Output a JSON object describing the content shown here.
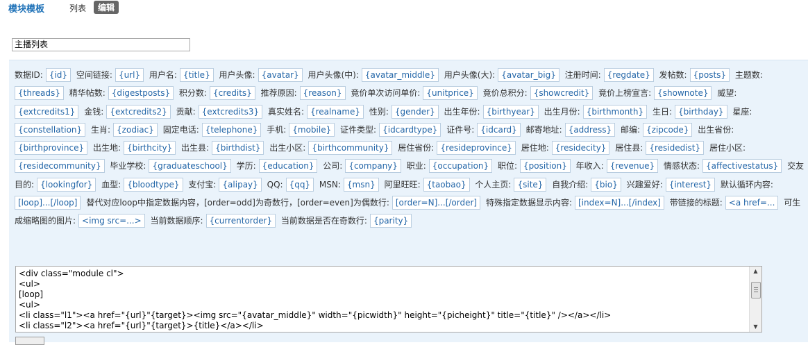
{
  "header": {
    "title": "模块模板",
    "tab_list": "列表",
    "tab_edit": "编辑"
  },
  "form": {
    "name_value": "主播列表"
  },
  "help": {
    "fields": [
      [
        "数据ID:",
        "{id}"
      ],
      [
        "空间链接:",
        "{url}"
      ],
      [
        "用户名:",
        "{title}"
      ],
      [
        "用户头像:",
        "{avatar}"
      ],
      [
        "用户头像(中):",
        "{avatar_middle}"
      ],
      [
        "用户头像(大):",
        "{avatar_big}"
      ],
      [
        "注册时间:",
        "{regdate}"
      ],
      [
        "发帖数:",
        "{posts}"
      ],
      [
        "主题数:",
        "{threads}"
      ],
      [
        "精华帖数:",
        "{digestposts}"
      ],
      [
        "积分数:",
        "{credits}"
      ],
      [
        "推荐原因:",
        "{reason}"
      ],
      [
        "竟价单次访问单价:",
        "{unitprice}"
      ],
      [
        "竟价总积分:",
        "{showcredit}"
      ],
      [
        "竟价上榜宣言:",
        "{shownote}"
      ],
      [
        "威望:",
        "{extcredits1}"
      ],
      [
        "金钱:",
        "{extcredits2}"
      ],
      [
        "贡献:",
        "{extcredits3}"
      ],
      [
        "真实姓名:",
        "{realname}"
      ],
      [
        "性别:",
        "{gender}"
      ],
      [
        "出生年份:",
        "{birthyear}"
      ],
      [
        "出生月份:",
        "{birthmonth}"
      ],
      [
        "生日:",
        "{birthday}"
      ],
      [
        "星座:",
        "{constellation}"
      ],
      [
        "生肖:",
        "{zodiac}"
      ],
      [
        "固定电话:",
        "{telephone}"
      ],
      [
        "手机:",
        "{mobile}"
      ],
      [
        "证件类型:",
        "{idcardtype}"
      ],
      [
        "证件号:",
        "{idcard}"
      ],
      [
        "邮寄地址:",
        "{address}"
      ],
      [
        "邮编:",
        "{zipcode}"
      ],
      [
        "出生省份:",
        "{birthprovince}"
      ],
      [
        "出生地:",
        "{birthcity}"
      ],
      [
        "出生县:",
        "{birthdist}"
      ],
      [
        "出生小区:",
        "{birthcommunity}"
      ],
      [
        "居住省份:",
        "{resideprovince}"
      ],
      [
        "居住地:",
        "{residecity}"
      ],
      [
        "居住县:",
        "{residedist}"
      ],
      [
        "居住小区:",
        "{residecommunity}"
      ],
      [
        "毕业学校:",
        "{graduateschool}"
      ],
      [
        "学历:",
        "{education}"
      ],
      [
        "公司:",
        "{company}"
      ],
      [
        "职业:",
        "{occupation}"
      ],
      [
        "职位:",
        "{position}"
      ],
      [
        "年收入:",
        "{revenue}"
      ],
      [
        "情感状态:",
        "{affectivestatus}"
      ],
      [
        "交友目的:",
        "{lookingfor}"
      ],
      [
        "血型:",
        "{bloodtype}"
      ],
      [
        "支付宝:",
        "{alipay}"
      ],
      [
        "QQ:",
        "{qq}"
      ],
      [
        "MSN:",
        "{msn}"
      ],
      [
        "阿里旺旺:",
        "{taobao}"
      ],
      [
        "个人主页:",
        "{site}"
      ],
      [
        "自我介绍:",
        "{bio}"
      ],
      [
        "兴趣爱好:",
        "{interest}"
      ],
      [
        "默认循环内容:",
        "[loop]...[/loop]"
      ],
      [
        "替代对应loop中指定数据内容，[order=odd]为奇数行，[order=even]为偶数行:",
        "[order=N]...[/order]"
      ],
      [
        "特殊指定数据显示内容:",
        "[index=N]...[/index]"
      ],
      [
        "带链接的标题:",
        "<a href=..."
      ],
      [
        "可生成缩略图的图片:",
        "<img src=...>"
      ],
      [
        "当前数据顺序:",
        "{currentorder}"
      ],
      [
        "当前数据是否在奇数行:",
        "{parity}"
      ]
    ]
  },
  "code": {
    "lines": [
      "<div class=\"module cl\">",
      "<ul>",
      "[loop]",
      "<ul>",
      "<li class=\"l1\"><a href=\"{url}\"{target}><img src=\"{avatar_middle}\" width=\"{picwidth}\" height=\"{picheight}\" title=\"{title}\" /></a></li>",
      "<li class=\"l2\"><a href=\"{url}\"{target}>{title}</a></li>"
    ]
  }
}
